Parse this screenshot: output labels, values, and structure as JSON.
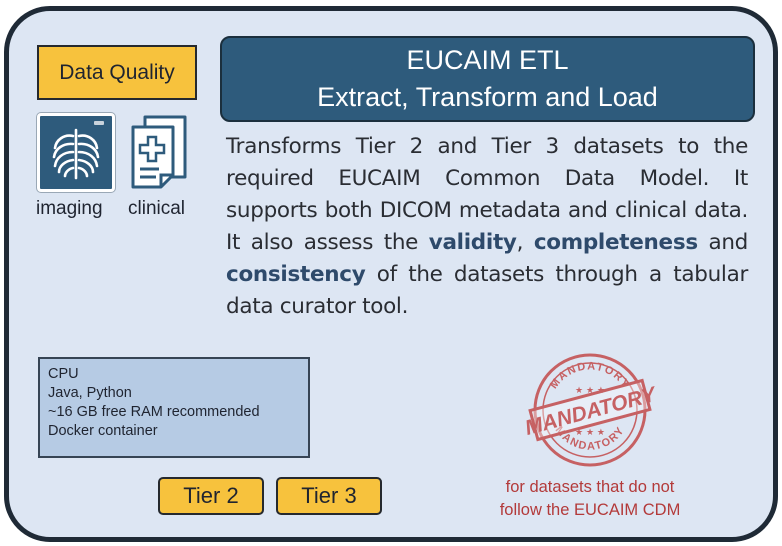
{
  "badge": {
    "label": "Data Quality",
    "color": "#f7c23d"
  },
  "title": {
    "line1": "EUCAIM ETL",
    "line2": "Extract, Transform and Load",
    "bg_color": "#2e5b7c"
  },
  "icons": {
    "imaging": {
      "icon": "ribcage-xray-icon",
      "label": "imaging"
    },
    "clinical": {
      "icon": "medical-document-icon",
      "label": "clinical"
    }
  },
  "description": {
    "part1": "Transforms Tier 2 and Tier 3 datasets to the required EUCAIM Common Data Model. It supports both DICOM metadata and clinical data. It also assess the ",
    "bold1": "validity",
    "sep1": ", ",
    "bold2": "completeness",
    "sep2": " and ",
    "bold3": "consistency",
    "part2": " of the datasets through a tabular data curator tool."
  },
  "requirements": [
    "CPU",
    "Java, Python",
    "~16 GB free RAM recommended",
    "Docker container"
  ],
  "tiers": [
    "Tier 2",
    "Tier 3"
  ],
  "stamp": {
    "main": "MANDATORY",
    "arc_top": "MANDATORY",
    "arc_bottom": "MANDATORY",
    "color": "#c24a4a"
  },
  "stamp_note": {
    "line1": "for datasets that do not",
    "line2": "follow the EUCAIM CDM"
  }
}
